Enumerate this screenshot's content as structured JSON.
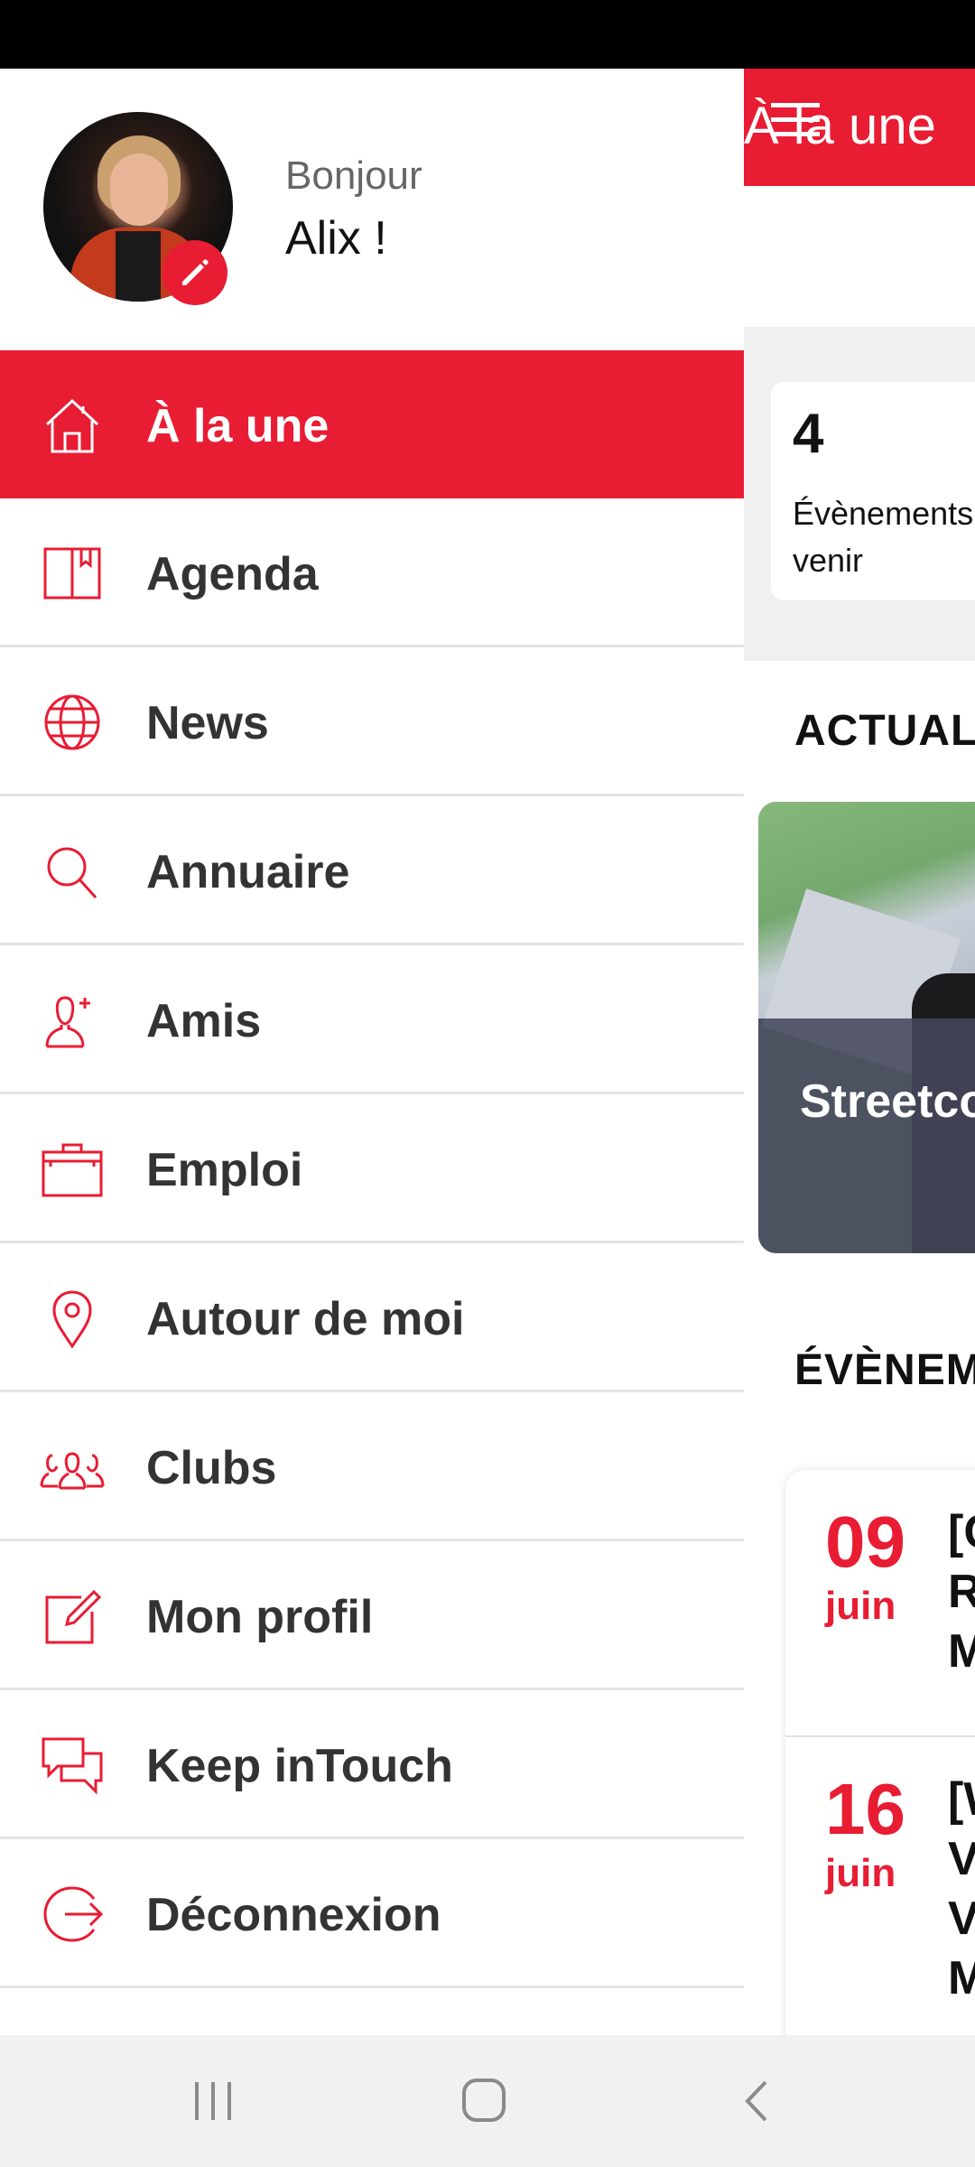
{
  "main": {
    "header_title": "À la une",
    "stat": {
      "value": "4",
      "label": "Évènements à venir"
    },
    "news_section_title": "ACTUALITÉS",
    "news_card_title": "Streetco, le GPS piéton",
    "events_section_title": "ÉVÈNEMENTS",
    "events": [
      {
        "day": "09",
        "month": "juin",
        "title": "[C\nR\nM"
      },
      {
        "day": "16",
        "month": "juin",
        "title": "[W\nV\nV\nM"
      }
    ]
  },
  "drawer": {
    "greeting": "Bonjour",
    "user_name": "Alix !",
    "menu": [
      {
        "label": "À la une",
        "icon": "home-icon",
        "active": true
      },
      {
        "label": "Agenda",
        "icon": "book-icon"
      },
      {
        "label": "News",
        "icon": "globe-icon"
      },
      {
        "label": "Annuaire",
        "icon": "search-icon"
      },
      {
        "label": "Amis",
        "icon": "add-friend-icon"
      },
      {
        "label": "Emploi",
        "icon": "briefcase-icon"
      },
      {
        "label": "Autour de moi",
        "icon": "location-pin-icon"
      },
      {
        "label": "Clubs",
        "icon": "group-icon"
      },
      {
        "label": "Mon profil",
        "icon": "edit-profile-icon"
      },
      {
        "label": "Keep inTouch",
        "icon": "chat-icon"
      },
      {
        "label": "Déconnexion",
        "icon": "logout-icon"
      }
    ]
  },
  "colors": {
    "accent": "#e81c33"
  }
}
